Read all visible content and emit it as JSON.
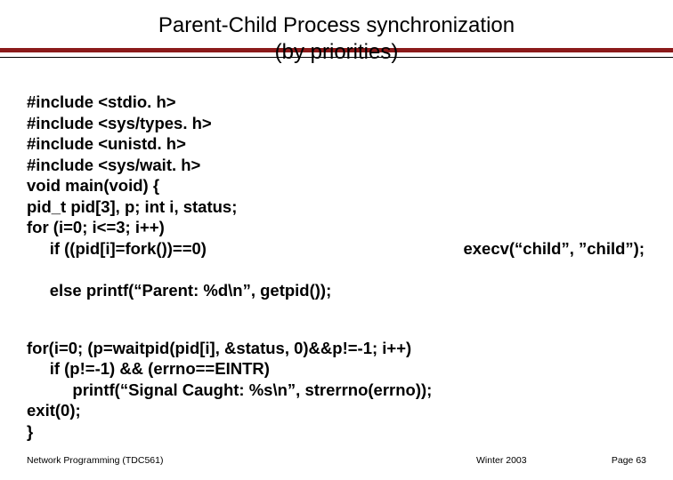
{
  "title": {
    "line1": "Parent-Child Process synchronization",
    "line2": "(by priorities)"
  },
  "code1": {
    "l1": "#include <stdio. h>",
    "l2": "#include <sys/types. h>",
    "l3": "#include <unistd. h>",
    "l4": "#include <sys/wait. h>",
    "l5": "void main(void) {",
    "l6": "pid_t pid[3], p; int i, status;",
    "l7": "for (i=0; i<=3; i++)",
    "l8_left": "     if ((pid[i]=fork())==0)",
    "l8_right": "execv(“child”, ”child”);",
    "l9": "     else printf(“Parent: %d\\n”, getpid());"
  },
  "code2": {
    "l1": "for(i=0; (p=waitpid(pid[i], &status, 0)&&p!=-1; i++)",
    "l2": "     if (p!=-1) && (errno==EINTR)",
    "l3": "          printf(“Signal Caught: %s\\n”, strerrno(errno));",
    "l4": "exit(0);",
    "l5": "}"
  },
  "footer": {
    "left": "Network Programming (TDC561)",
    "mid": "Winter  2003",
    "right": "Page 63"
  }
}
